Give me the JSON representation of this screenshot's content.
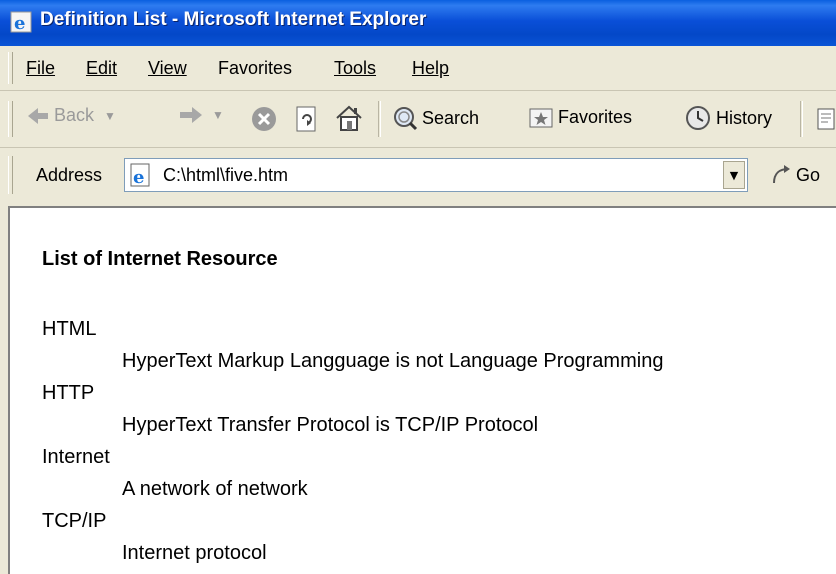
{
  "window": {
    "title": "Definition List - Microsoft Internet Explorer"
  },
  "menu": {
    "items": [
      "File",
      "Edit",
      "View",
      "Favorites",
      "Tools",
      "Help"
    ]
  },
  "toolbar": {
    "back": "Back",
    "search": "Search",
    "favorites": "Favorites",
    "history": "History"
  },
  "address": {
    "label": "Address",
    "url": "C:\\html\\five.htm",
    "go": "Go"
  },
  "page": {
    "heading": "List of Internet Resource",
    "definitions": [
      {
        "term": "HTML",
        "description": "HyperText Markup Langguage is not Language Programming"
      },
      {
        "term": "HTTP",
        "description": "HyperText Transfer Protocol is TCP/IP Protocol"
      },
      {
        "term": "Internet",
        "description": "A network of network"
      },
      {
        "term": "TCP/IP",
        "description": "Internet protocol"
      }
    ]
  }
}
